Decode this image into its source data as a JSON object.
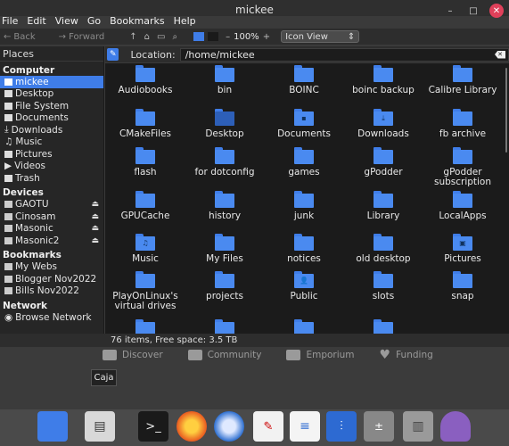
{
  "window": {
    "title": "mickee"
  },
  "menu": [
    "File",
    "Edit",
    "View",
    "Go",
    "Bookmarks",
    "Help"
  ],
  "toolbar": {
    "back": "Back",
    "forward": "Forward",
    "zoom": "100%",
    "view_mode": "Icon View"
  },
  "sidebar": {
    "header": "Places",
    "computer_label": "Computer",
    "computer": [
      "mickee",
      "Desktop",
      "File System",
      "Documents",
      "Downloads",
      "Music",
      "Pictures",
      "Videos",
      "Trash"
    ],
    "devices_label": "Devices",
    "devices": [
      "GAOTU",
      "Cinosam",
      "Masonic",
      "Masonic2"
    ],
    "bookmarks_label": "Bookmarks",
    "bookmarks": [
      "My Webs",
      "Blogger Nov2022",
      "Bills Nov2022"
    ],
    "network_label": "Network",
    "network": [
      "Browse Network"
    ]
  },
  "location": {
    "label": "Location:",
    "path": "/home/mickee"
  },
  "files": [
    "Audiobooks",
    "bin",
    "BOINC",
    "boinc backup",
    "Calibre Library",
    "CMakeFiles",
    "Desktop",
    "Documents",
    "Downloads",
    "fb archive",
    "flash",
    "for dotconfig",
    "games",
    "gPodder",
    "gPodder subscription",
    "GPUCache",
    "history",
    "junk",
    "Library",
    "LocalApps",
    "Music",
    "My Files",
    "notices",
    "old desktop",
    "Pictures",
    "PlayOnLinux's virtual drives",
    "projects",
    "Public",
    "slots",
    "snap"
  ],
  "status": "76 items, Free space: 3.5 TB",
  "background_nav": [
    "Discover",
    "Community",
    "Emporium",
    "Funding"
  ],
  "tooltip": "Caja",
  "colors": {
    "accent": "#3f7de8",
    "folder": "#4a8af0"
  }
}
